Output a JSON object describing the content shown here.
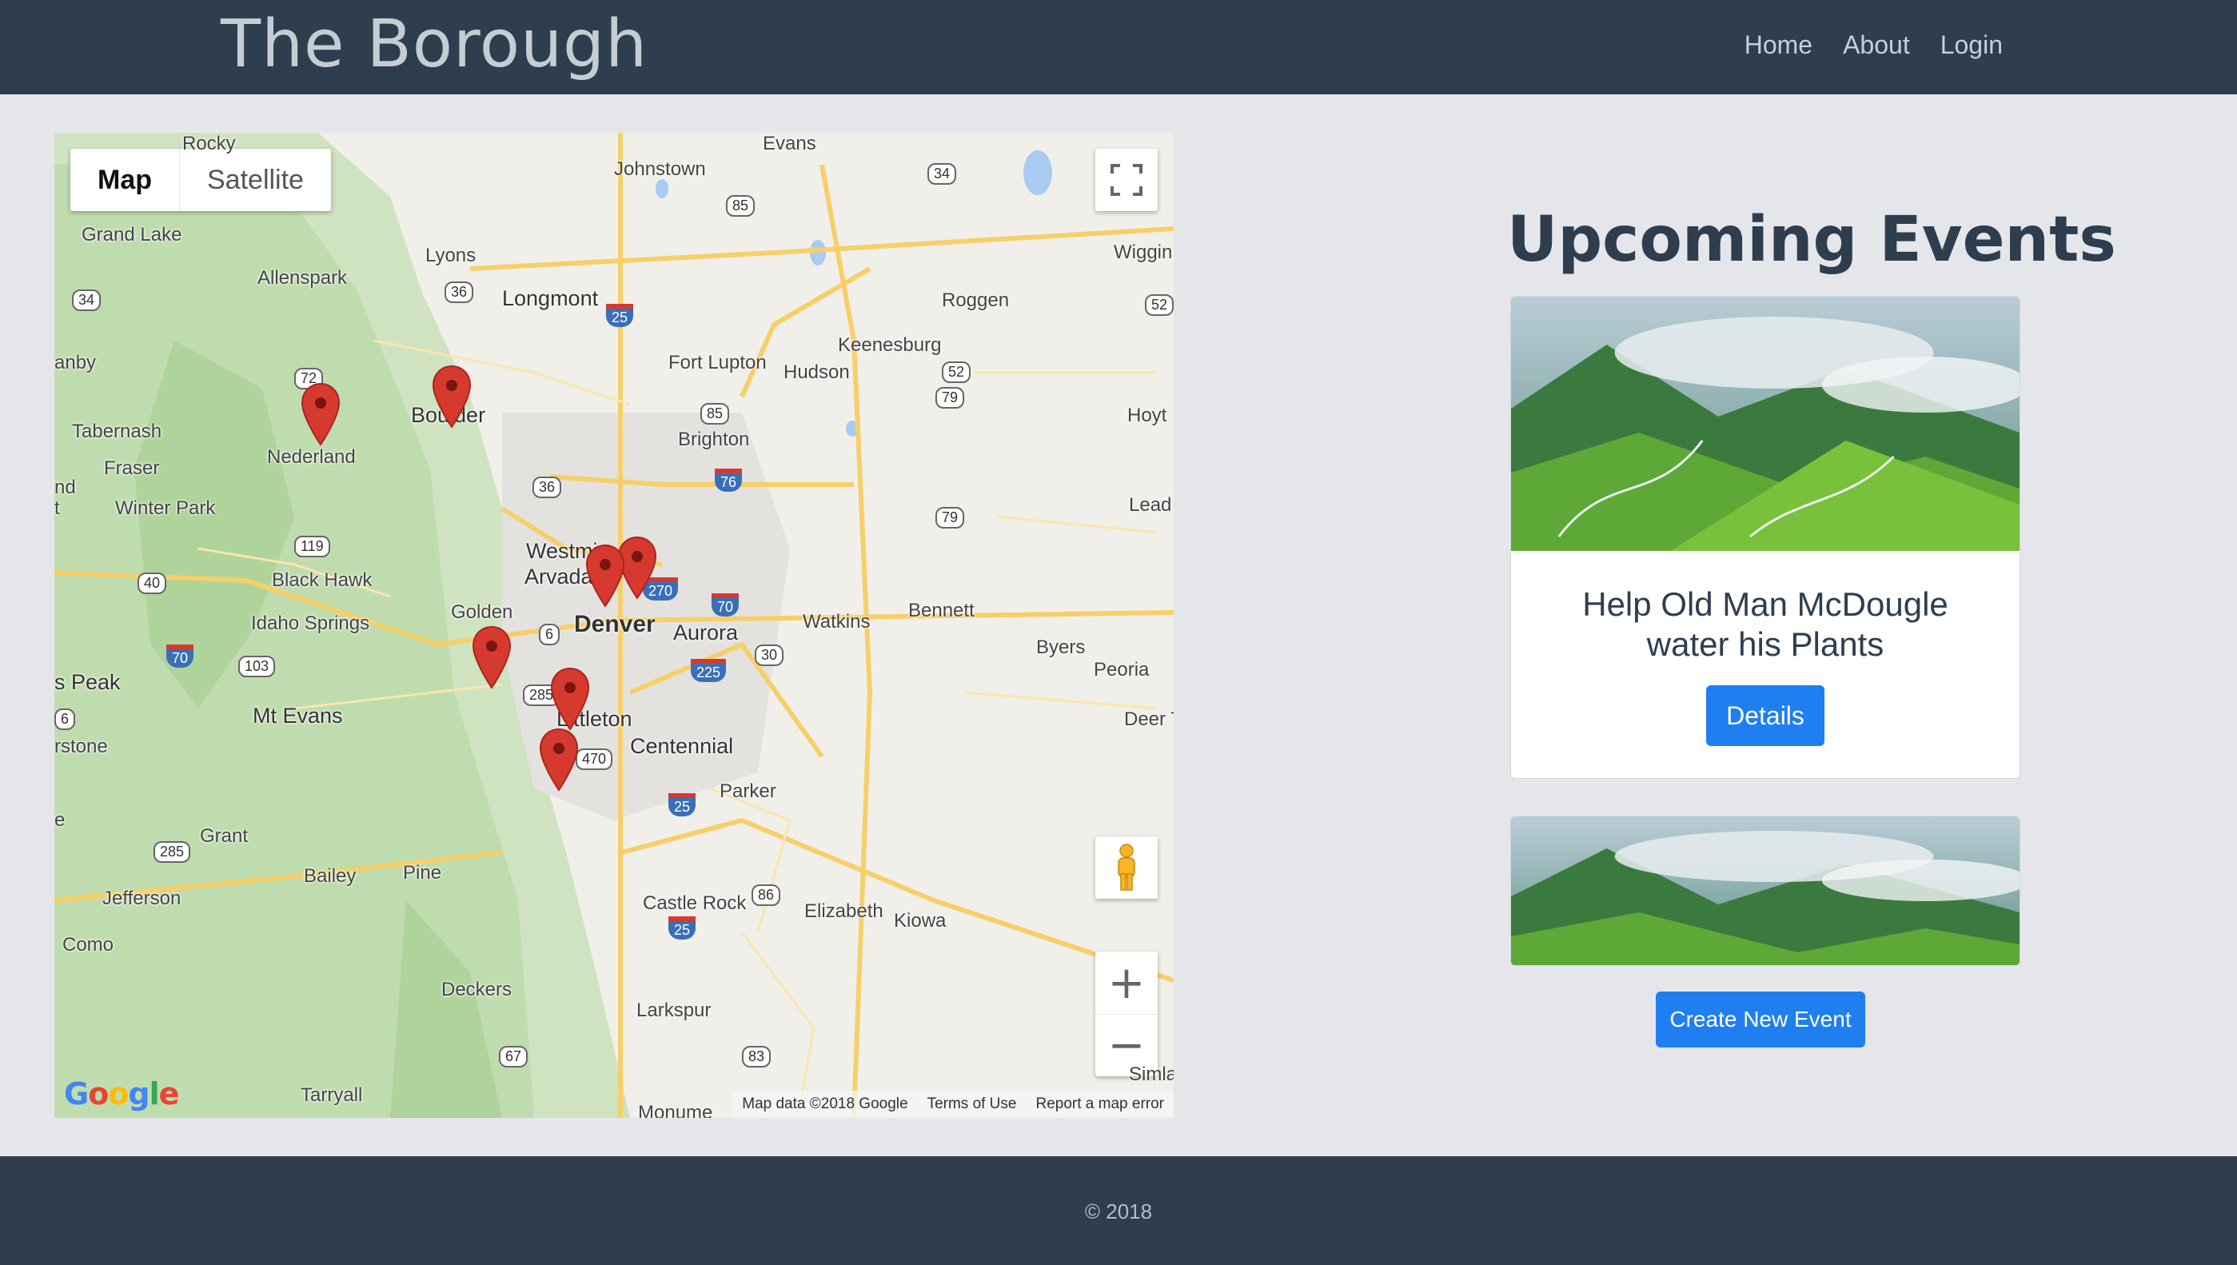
{
  "header": {
    "brand": "The Borough",
    "nav": [
      "Home",
      "About",
      "Login"
    ]
  },
  "map": {
    "type_control": [
      "Map",
      "Satellite"
    ],
    "places": [
      {
        "name": "Evans"
      },
      {
        "name": "Johnstown"
      },
      {
        "name": "Wiggin"
      },
      {
        "name": "Rocky"
      },
      {
        "name": "Grand Lake"
      },
      {
        "name": "Allenspark"
      },
      {
        "name": "Lyons"
      },
      {
        "name": "Longmont"
      },
      {
        "name": "Roggen"
      },
      {
        "name": "Keenesburg"
      },
      {
        "name": "Fort Lupton"
      },
      {
        "name": "Hudson"
      },
      {
        "name": "anby"
      },
      {
        "name": "Tabernash"
      },
      {
        "name": "Boulder"
      },
      {
        "name": "Brighton"
      },
      {
        "name": "Hoyt"
      },
      {
        "name": "Nederland"
      },
      {
        "name": "Fraser"
      },
      {
        "name": "nd"
      },
      {
        "name": "t"
      },
      {
        "name": "Winter Park"
      },
      {
        "name": "Lead"
      },
      {
        "name": "Westmi"
      },
      {
        "name": "Arvada"
      },
      {
        "name": "Black Hawk"
      },
      {
        "name": "Golden"
      },
      {
        "name": "Idaho Springs"
      },
      {
        "name": "Denver"
      },
      {
        "name": "Aurora"
      },
      {
        "name": "Watkins"
      },
      {
        "name": "Bennett"
      },
      {
        "name": "Byers"
      },
      {
        "name": "Peoria"
      },
      {
        "name": "s Peak"
      },
      {
        "name": "Mt Evans"
      },
      {
        "name": "Littleton"
      },
      {
        "name": "Deer T"
      },
      {
        "name": "rstone"
      },
      {
        "name": "Centennial"
      },
      {
        "name": "Parker"
      },
      {
        "name": "e"
      },
      {
        "name": "Grant"
      },
      {
        "name": "Bailey"
      },
      {
        "name": "Pine"
      },
      {
        "name": "Jefferson"
      },
      {
        "name": "Castle Rock"
      },
      {
        "name": "Elizabeth"
      },
      {
        "name": "Kiowa"
      },
      {
        "name": "Como"
      },
      {
        "name": "Deckers"
      },
      {
        "name": "Larkspur"
      },
      {
        "name": "Tarryall"
      },
      {
        "name": "Monume"
      },
      {
        "name": "Simla"
      }
    ],
    "shields": [
      "34",
      "85",
      "52",
      "36",
      "34",
      "25",
      "72",
      "52",
      "79",
      "85",
      "36",
      "76",
      "79",
      "119",
      "40",
      "270",
      "70",
      "6",
      "30",
      "70",
      "103",
      "225",
      "6",
      "285",
      "470",
      "25",
      "285",
      "86",
      "25",
      "67",
      "83"
    ],
    "markers": 8,
    "footer": {
      "data": "Map data ©2018 Google",
      "terms": "Terms of Use",
      "report": "Report a map error"
    },
    "logo": "Google"
  },
  "events": {
    "title": "Upcoming Events",
    "cards": [
      {
        "title": "Help Old Man McDougle water his Plants",
        "button": "Details"
      }
    ],
    "create_button": "Create New Event"
  },
  "footer": {
    "copyright": "© 2018"
  },
  "colors": {
    "header_bg": "#2e3e4f",
    "page_bg": "#e5e6ea",
    "accent": "#1f7ff1",
    "marker": "#d63a2f"
  }
}
